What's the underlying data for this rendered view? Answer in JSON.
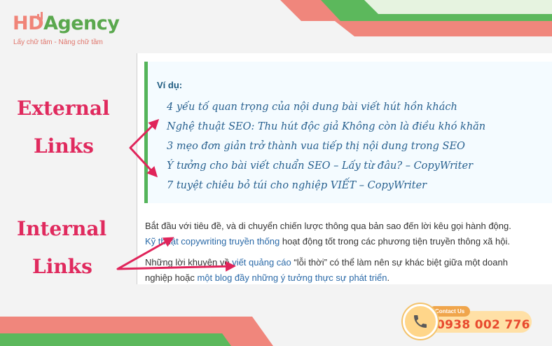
{
  "logo": {
    "brand_hd": "HD",
    "brand_rest": "Agency",
    "tagline": "Lấy chữ tâm - Nâng chữ tầm"
  },
  "labels": {
    "external_line1": "External",
    "external_line2": "Links",
    "internal_line1": "Internal",
    "internal_line2": "Links"
  },
  "example": {
    "title": "Ví dụ:",
    "links": [
      "4 yếu tố quan trọng của nội dung bài viết hút hồn khách",
      "Nghệ thuật SEO: Thu hút độc giả Không còn là điều khó khăn",
      "3 mẹo đơn giản trở thành vua tiếp thị nội dung trong SEO",
      "Ý tưởng cho bài viết chuẩn SEO – Lấy từ đâu? – CopyWriter",
      "7 tuyệt chiêu bỏ túi cho nghiệp VIẾT – CopyWriter"
    ]
  },
  "para1": {
    "line1": "Bắt đầu với tiêu đề, và di chuyển chiến lược thông qua bản sao đến lời kêu gọi hành động.",
    "link": "Kỹ thuật copywriting truyền thống",
    "line2_rest": " hoạt động tốt trong các phương tiện truyền thông xã hội."
  },
  "para2": {
    "pre": "Những lời khuyên về ",
    "link1": "viết quảng cáo",
    "mid": " “lỗi thời” có thể làm nên sự khác biệt giữa một doanh",
    "line2_pre": "nghiệp hoặc ",
    "link2": "một blog đầy những ý tưởng thực sự phát triển",
    "line2_end": "."
  },
  "contact": {
    "tag": "Contact Us",
    "phone": "0938 002 776",
    "icon": "phone-icon"
  },
  "colors": {
    "pink": "#f0867c",
    "green": "#5cb85c",
    "label_red": "#e02a5e",
    "link_blue": "#27608f",
    "arrow": "#e0245a"
  }
}
